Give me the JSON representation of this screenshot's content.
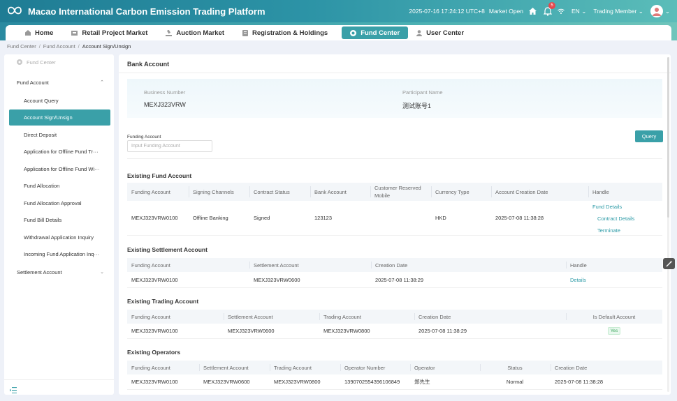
{
  "app": {
    "title": "Macao International Carbon Emission Trading Platform"
  },
  "topbar": {
    "datetime": "2025-07-16 17:24:12 UTC+8",
    "market_status": "Market Open",
    "notification_count": "5",
    "language": "EN",
    "member": "Trading Member"
  },
  "nav": {
    "tabs": [
      {
        "label": "Home",
        "icon": "home-icon"
      },
      {
        "label": "Retail Project Market",
        "icon": "shop-icon"
      },
      {
        "label": "Auction Market",
        "icon": "gavel-icon"
      },
      {
        "label": "Registration & Holdings",
        "icon": "document-icon"
      },
      {
        "label": "Fund Center",
        "icon": "fund-icon",
        "active": true
      },
      {
        "label": "User Center",
        "icon": "user-icon"
      }
    ]
  },
  "breadcrumb": [
    "Fund Center",
    "Fund Account",
    "Account Sign/Unsign"
  ],
  "sidebar": {
    "header": "Fund Center",
    "fund_account": "Fund Account",
    "items": [
      "Account Query",
      "Account Sign/Unsign",
      "Direct Deposit",
      "Application for Offline Fund Tr···",
      "Application for Offline Fund Wi···",
      "Fund Allocation",
      "Fund Allocation Approval",
      "Fund Bill Details",
      "Withdrawal Application Inquiry",
      "Incoming Fund Application Inq···"
    ],
    "settlement_account": "Settlement Account"
  },
  "main": {
    "title": "Bank Account",
    "info": {
      "business_number_label": "Business Number",
      "business_number": "MEXJ323VRW",
      "participant_name_label": "Participant Name",
      "participant_name": "测试账号1"
    },
    "search": {
      "label": "Funding Account",
      "placeholder": "Input Funding Account",
      "query_button": "Query"
    },
    "fund_section": {
      "title": "Existing Fund Account",
      "headers": [
        "Funding Account",
        "Signing Channels",
        "Contract Status",
        "Bank Account",
        "Customer Reserved Mobile",
        "Currency Type",
        "Account Creation Date",
        "Handle"
      ],
      "row": {
        "funding_account": "MEXJ323VRW0100",
        "signing_channel": "Offline Banking",
        "contract_status": "Signed",
        "bank_account": "123123",
        "mobile": "",
        "currency": "HKD",
        "creation_date": "2025-07-08 11:38:28",
        "actions": [
          "Fund Details",
          "Contract Details",
          "Terminate"
        ]
      }
    },
    "settlement_section": {
      "title": "Existing Settlement Account",
      "headers": [
        "Funding Account",
        "Settlement Account",
        "Creation Date",
        "Handle"
      ],
      "row": {
        "funding_account": "MEXJ323VRW0100",
        "settlement_account": "MEXJ323VRW0600",
        "creation_date": "2025-07-08 11:38:29",
        "action": "Details"
      }
    },
    "trading_section": {
      "title": "Existing Trading Account",
      "headers": [
        "Funding Account",
        "Settlement Account",
        "Trading Account",
        "Creation Date",
        "Is Default Account"
      ],
      "row": {
        "funding_account": "MEXJ323VRW0100",
        "settlement_account": "MEXJ323VRW0600",
        "trading_account": "MEXJ323VRW0800",
        "creation_date": "2025-07-08 11:38:29",
        "is_default": "Yes"
      }
    },
    "operators_section": {
      "title": "Existing Operators",
      "headers": [
        "Funding Account",
        "Settlement Account",
        "Trading Account",
        "Operator Number",
        "Operator",
        "Status",
        "Creation Date"
      ],
      "row": {
        "funding_account": "MEXJ323VRW0100",
        "settlement_account": "MEXJ323VRW0600",
        "trading_account": "MEXJ323VRW0800",
        "operator_number": "1390702554396106849",
        "operator": "郑先生",
        "status": "Normal",
        "creation_date": "2025-07-08 11:38:28"
      }
    }
  },
  "colors": {
    "accent": "#3aa0a8",
    "link": "#2b9aa6",
    "header_bg": "#1f7c94"
  }
}
